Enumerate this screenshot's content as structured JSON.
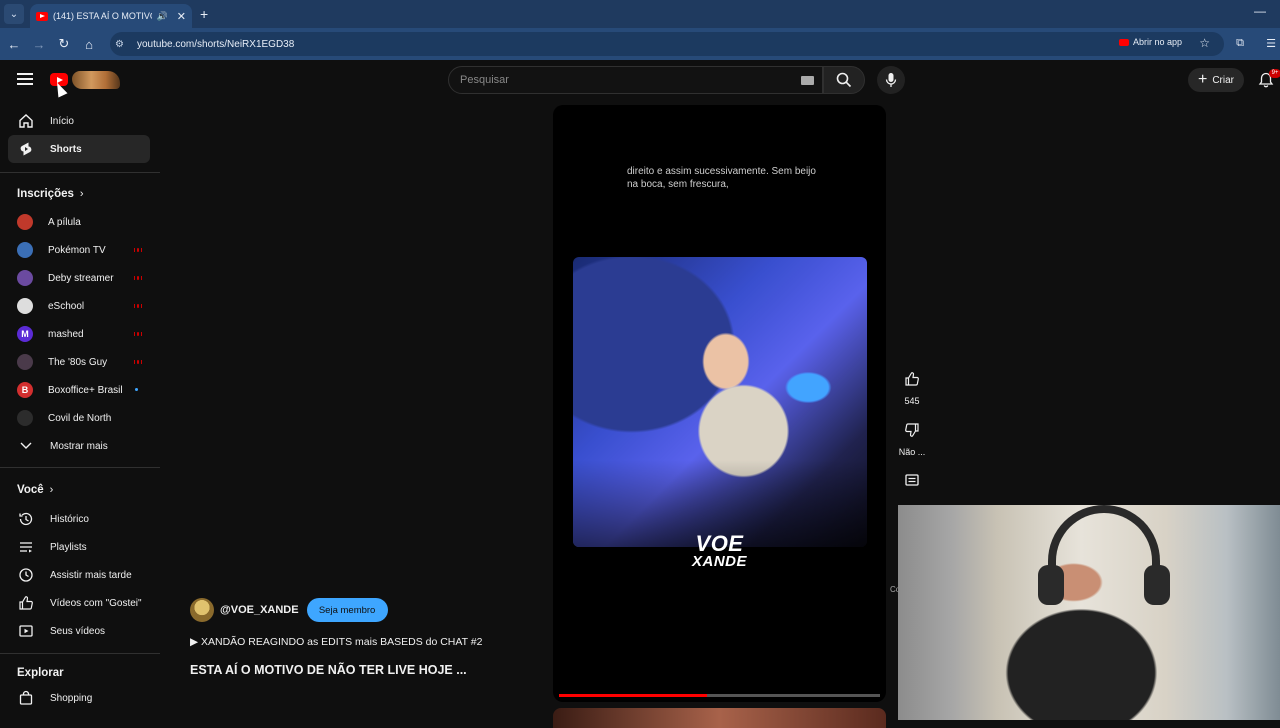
{
  "browser": {
    "tab_title": "(141) ESTA AÍ O MOTIVO DE",
    "url": "youtube.com/shorts/NeiRX1EGD38",
    "open_in_app": "Abrir no app"
  },
  "header": {
    "search_placeholder": "Pesquisar",
    "create_label": "Criar",
    "notification_count": "9+"
  },
  "sidebar": {
    "main": [
      {
        "label": "Início",
        "icon": "home-icon"
      },
      {
        "label": "Shorts",
        "icon": "shorts-icon",
        "active": true
      }
    ],
    "subscriptions_heading": "Inscrições",
    "subscriptions": [
      {
        "label": "A pílula",
        "color": "#c0392b",
        "indicator": "none"
      },
      {
        "label": "Pokémon TV",
        "color": "#3b6fb6",
        "indicator": "live"
      },
      {
        "label": "Deby streamer",
        "color": "#6b4aa0",
        "indicator": "live"
      },
      {
        "label": "eSchool",
        "color": "#dddddd",
        "indicator": "live"
      },
      {
        "label": "mashed",
        "color": "#5b2bd6",
        "indicator": "live"
      },
      {
        "label": "The '80s Guy",
        "color": "#4a3a4a",
        "indicator": "live"
      },
      {
        "label": "Boxoffice+ Brasil",
        "color": "#d32f2f",
        "indicator": "new"
      },
      {
        "label": "Covil de North",
        "color": "#2c2c2c",
        "indicator": "none"
      }
    ],
    "show_more": "Mostrar mais",
    "you_heading": "Você",
    "you_items": [
      {
        "label": "Histórico",
        "icon": "history-icon"
      },
      {
        "label": "Playlists",
        "icon": "playlists-icon"
      },
      {
        "label": "Assistir mais tarde",
        "icon": "watch-later-icon"
      },
      {
        "label": "Vídeos com \"Gostei\"",
        "icon": "like-icon"
      },
      {
        "label": "Seus vídeos",
        "icon": "your-videos-icon"
      }
    ],
    "explore_heading": "Explorar",
    "explore_items": [
      {
        "label": "Shopping",
        "icon": "shopping-bag-icon"
      }
    ]
  },
  "short": {
    "caption": "direito e assim sucessivamente. Sem beijo na boca, sem frescura,",
    "watermark_line1": "VOE",
    "watermark_line2": "XANDE",
    "progress": 0.46,
    "like_count": "545",
    "dislike_label": "Não ...",
    "channel": "@VOE_XANDE",
    "member_button": "Seja membro",
    "playlist": "▶ XANDÃO REAGINDO as EDITS mais BASEDS do CHAT #2",
    "title": "ESTA AÍ O MOTIVO DE NÃO TER LIVE HOJE  ...",
    "comments_partial": "Co"
  },
  "colors": {
    "accent_red": "#ff0000",
    "member_blue": "#3ea6ff",
    "background": "#0f0f0f",
    "browser_frame": "#274a78"
  }
}
